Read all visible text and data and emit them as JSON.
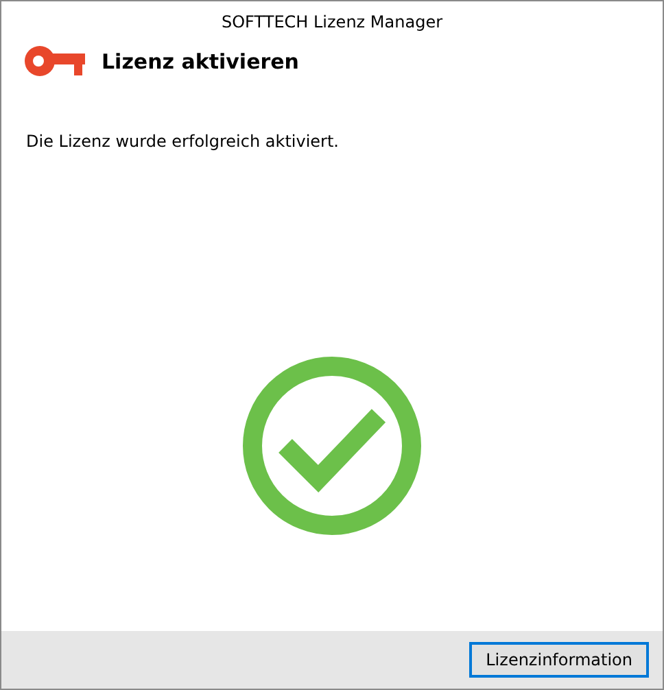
{
  "window": {
    "title": "SOFTTECH Lizenz Manager"
  },
  "header": {
    "title": "Lizenz aktivieren"
  },
  "message": "Die Lizenz wurde erfolgreich aktiviert.",
  "status": {
    "kind": "success"
  },
  "buttons": [
    {
      "label": "Lizenzinformation",
      "focused": true
    }
  ]
}
